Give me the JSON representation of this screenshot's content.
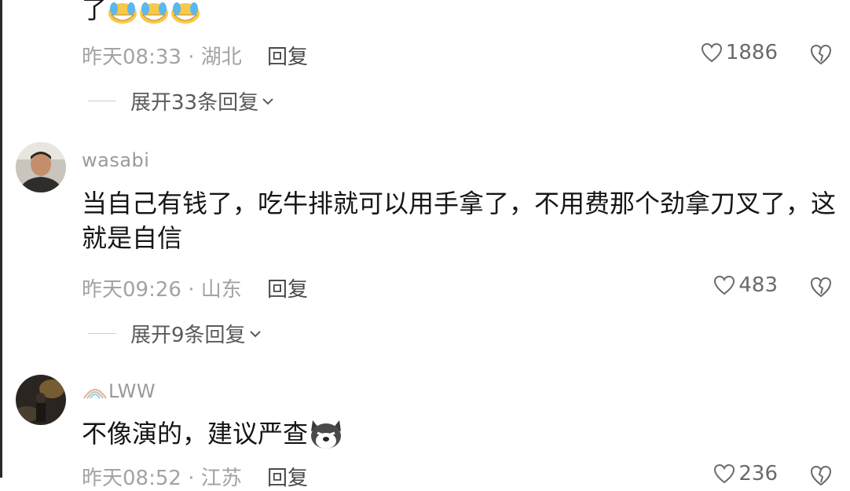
{
  "comments": [
    {
      "content_tail": "了",
      "time": "昨天08:33",
      "location": "湖北",
      "reply_label": "回复",
      "likes": "1886",
      "expand": "展开33条回复"
    },
    {
      "username": "wasabi",
      "content": "当自己有钱了，吃牛排就可以用手拿了，不用费那个劲拿刀叉了，这就是自信",
      "time": "昨天09:26",
      "location": "山东",
      "reply_label": "回复",
      "likes": "483",
      "expand": "展开9条回复"
    },
    {
      "username": "LWW",
      "content": "不像演的，建议严查",
      "time": "昨天08:52",
      "location": "江苏",
      "reply_label": "回复",
      "likes": "236"
    }
  ],
  "separator": " · ",
  "icons": [
    "laughing-crying-emoji",
    "heart-icon",
    "broken-heart-icon",
    "chevron-down-icon",
    "rainbow-icon",
    "husky-emoji"
  ]
}
